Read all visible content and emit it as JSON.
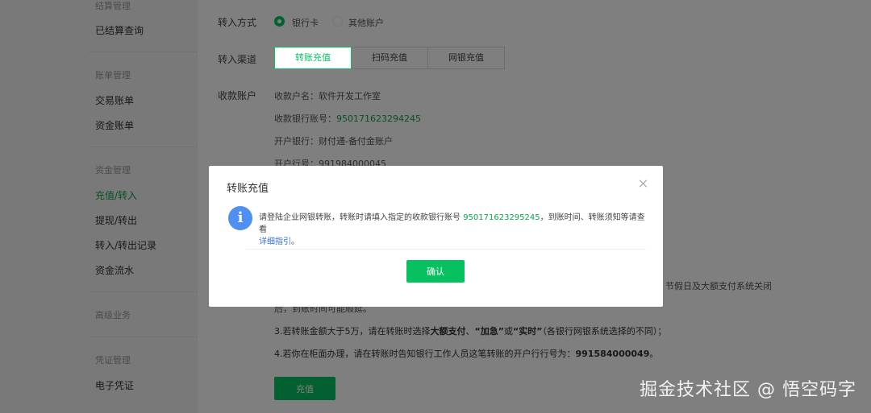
{
  "sidebar": {
    "groups": [
      {
        "title": "结算管理"
      },
      {
        "title": "账单管理"
      },
      {
        "title": "资金管理"
      },
      {
        "title": "高级业务"
      },
      {
        "title": "凭证管理"
      }
    ],
    "items": {
      "settled_query": "已结算查询",
      "trade_bill": "交易账单",
      "fund_bill": "资金账单",
      "recharge_transfer_in": "充值/转入",
      "withdraw_transfer_out": "提现/转出",
      "transfer_records": "转入/转出记录",
      "fund_flow": "资金流水",
      "e_voucher": "电子凭证"
    },
    "active": "recharge_transfer_in"
  },
  "form": {
    "method_label": "转入方式",
    "method_options": [
      "银行卡",
      "其他账户"
    ],
    "method_selected": "银行卡",
    "channel_label": "转入渠道",
    "channel_tabs": [
      "转账充值",
      "扫码充值",
      "网银充值"
    ],
    "channel_active": "转账充值",
    "account_label": "收款账户",
    "account_name": "收款户名：软件开发工作室",
    "account_number_label": "收款银行账号：",
    "account_number": "950171623294245",
    "bank": "开户银行：财付通-备付金账户",
    "bank_code": "开户行号：991984000045"
  },
  "notes": {
    "line2_tail": "节假日及大额支付系统关闭",
    "line2_cont": "后，到账时间可能顺延。",
    "line3_pre": "3.若转账金额大于5万，请在转账时选择",
    "line3_b1": "大额支付",
    "line3_sep1": "、",
    "line3_b2": "“加急”",
    "line3_sep2": "或",
    "line3_b3": "“实时”",
    "line3_post": "（各银行网银系统选择的不同）；",
    "line4_pre": "4.若你在柜面办理，请在转账时告知银行工作人员这笔转账的开户行行号为：",
    "line4_b": "991584000049",
    "line4_post": "。"
  },
  "recharge_button": "充值",
  "modal": {
    "title": "转账充值",
    "message_pre": "请登陆企业网银转账，转账时请填入指定的收款银行账号 ",
    "message_account": "950171623295245",
    "message_post": "，到账时间、转账须知等请查看",
    "guide_link": "详细指引",
    "message_end": "。",
    "ok_label": "确认"
  },
  "watermark": "掘金技术社区 @ 悟空码字",
  "colors": {
    "accent": "#07c160",
    "info": "#4e8ff0",
    "link": "#3a6fcf"
  }
}
